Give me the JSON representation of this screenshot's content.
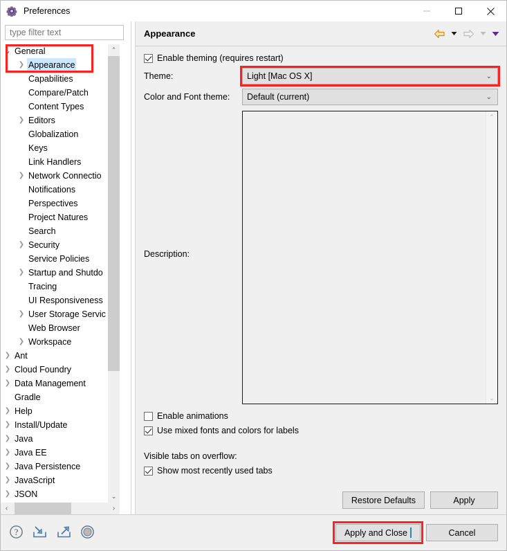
{
  "window": {
    "title": "Preferences",
    "icon": "gear-icon",
    "minimize_label": "—",
    "maximize_label": "□",
    "close_label": "✕"
  },
  "sidebar": {
    "filter_placeholder": "type filter text",
    "filter_value": "",
    "scroll": {
      "up_arrow": "⌃",
      "down_arrow": "⌄",
      "left_arrow": "‹",
      "right_arrow": "›"
    },
    "items": [
      {
        "label": "General",
        "level": 0,
        "twisty": "open",
        "selected": false
      },
      {
        "label": "Appearance",
        "level": 1,
        "twisty": "closed",
        "selected": true
      },
      {
        "label": "Capabilities",
        "level": 1,
        "twisty": "none",
        "selected": false
      },
      {
        "label": "Compare/Patch",
        "level": 1,
        "twisty": "none",
        "selected": false
      },
      {
        "label": "Content Types",
        "level": 1,
        "twisty": "none",
        "selected": false
      },
      {
        "label": "Editors",
        "level": 1,
        "twisty": "closed",
        "selected": false
      },
      {
        "label": "Globalization",
        "level": 1,
        "twisty": "none",
        "selected": false
      },
      {
        "label": "Keys",
        "level": 1,
        "twisty": "none",
        "selected": false
      },
      {
        "label": "Link Handlers",
        "level": 1,
        "twisty": "none",
        "selected": false
      },
      {
        "label": "Network Connectio",
        "level": 1,
        "twisty": "closed",
        "selected": false
      },
      {
        "label": "Notifications",
        "level": 1,
        "twisty": "none",
        "selected": false
      },
      {
        "label": "Perspectives",
        "level": 1,
        "twisty": "none",
        "selected": false
      },
      {
        "label": "Project Natures",
        "level": 1,
        "twisty": "none",
        "selected": false
      },
      {
        "label": "Search",
        "level": 1,
        "twisty": "none",
        "selected": false
      },
      {
        "label": "Security",
        "level": 1,
        "twisty": "closed",
        "selected": false
      },
      {
        "label": "Service Policies",
        "level": 1,
        "twisty": "none",
        "selected": false
      },
      {
        "label": "Startup and Shutdo",
        "level": 1,
        "twisty": "closed",
        "selected": false
      },
      {
        "label": "Tracing",
        "level": 1,
        "twisty": "none",
        "selected": false
      },
      {
        "label": "UI Responsiveness",
        "level": 1,
        "twisty": "none",
        "selected": false
      },
      {
        "label": "User Storage Servic",
        "level": 1,
        "twisty": "closed",
        "selected": false
      },
      {
        "label": "Web Browser",
        "level": 1,
        "twisty": "none",
        "selected": false
      },
      {
        "label": "Workspace",
        "level": 1,
        "twisty": "closed",
        "selected": false
      },
      {
        "label": "Ant",
        "level": 0,
        "twisty": "closed",
        "selected": false
      },
      {
        "label": "Cloud Foundry",
        "level": 0,
        "twisty": "closed",
        "selected": false
      },
      {
        "label": "Data Management",
        "level": 0,
        "twisty": "closed",
        "selected": false
      },
      {
        "label": "Gradle",
        "level": 0,
        "twisty": "none",
        "selected": false
      },
      {
        "label": "Help",
        "level": 0,
        "twisty": "closed",
        "selected": false
      },
      {
        "label": "Install/Update",
        "level": 0,
        "twisty": "closed",
        "selected": false
      },
      {
        "label": "Java",
        "level": 0,
        "twisty": "closed",
        "selected": false
      },
      {
        "label": "Java EE",
        "level": 0,
        "twisty": "closed",
        "selected": false
      },
      {
        "label": "Java Persistence",
        "level": 0,
        "twisty": "closed",
        "selected": false
      },
      {
        "label": "JavaScript",
        "level": 0,
        "twisty": "closed",
        "selected": false
      },
      {
        "label": "JSON",
        "level": 0,
        "twisty": "closed",
        "selected": false
      }
    ]
  },
  "pane": {
    "title": "Appearance",
    "nav": {
      "back_icon": "back-arrow-icon",
      "back_dropdown_icon": "chevron-down-icon",
      "forward_icon": "forward-arrow-icon",
      "forward_dropdown_icon": "chevron-down-icon",
      "menu_icon": "chevron-down-icon"
    },
    "enable_theming": {
      "label": "Enable theming (requires restart)",
      "checked": true
    },
    "theme": {
      "label": "Theme:",
      "value": "Light [Mac OS X]",
      "caret": "⌄",
      "highlighted": true
    },
    "color_font_theme": {
      "label": "Color and Font theme:",
      "value": "Default (current)",
      "caret": "⌄",
      "highlighted": false
    },
    "description": {
      "label": "Description:",
      "value": ""
    },
    "enable_animations": {
      "label": "Enable animations",
      "checked": false
    },
    "use_mixed_fonts": {
      "label": "Use mixed fonts and colors for labels",
      "checked": true
    },
    "visible_tabs_label": "Visible tabs on overflow:",
    "show_mru_tabs": {
      "label": "Show most recently used tabs",
      "checked": true
    },
    "restore_defaults_label": "Restore Defaults",
    "apply_label": "Apply"
  },
  "footer": {
    "help_icon": "help-icon",
    "import_icon": "import-icon",
    "export_icon": "export-icon",
    "disc_icon": "disc-icon",
    "apply_and_close_label": "Apply and Close",
    "cancel_label": "Cancel",
    "apply_and_close_highlighted": true
  },
  "colors": {
    "highlight_red": "#ff2020",
    "selection_blue": "#cce8ff",
    "back_arrow_gold": "#e8b23a",
    "purple": "#6b4a8f",
    "window_bg": "#f0f0f0"
  }
}
